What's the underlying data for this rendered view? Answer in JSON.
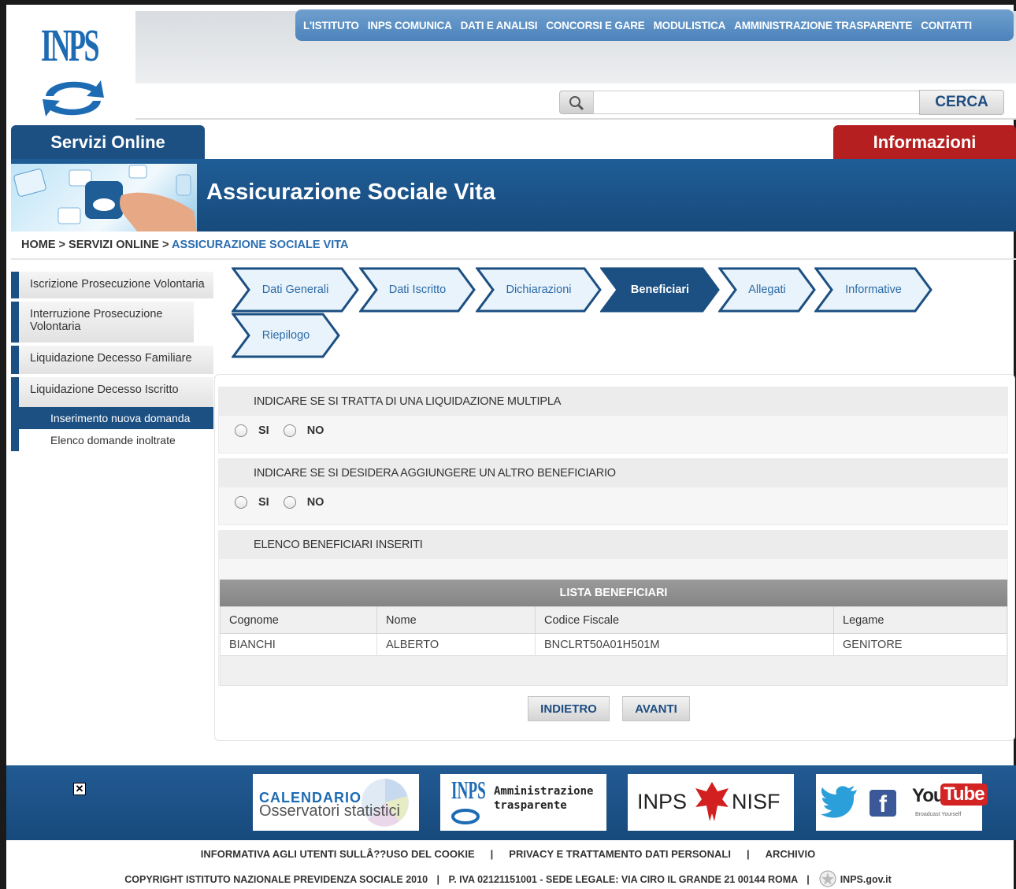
{
  "logo": {
    "text": "INPS"
  },
  "topnav": [
    "L'ISTITUTO",
    "INPS COMUNICA",
    "DATI E ANALISI",
    "CONCORSI E GARE",
    "MODULISTICA",
    "AMMINISTRAZIONE TRASPARENTE",
    "CONTATTI"
  ],
  "search": {
    "button": "CERCA",
    "placeholder": ""
  },
  "tabs": {
    "left": "Servizi Online",
    "right": "Informazioni"
  },
  "banner": {
    "title": "Assicurazione Sociale Vita"
  },
  "breadcrumb": {
    "home": "HOME",
    "sep": ">",
    "section": "SERVIZI ONLINE",
    "current": "ASSICURAZIONE SOCIALE VITA"
  },
  "sidebar": {
    "items": [
      "Iscrizione Prosecuzione Volontaria",
      "Interruzione Prosecuzione Volontaria",
      "Liquidazione Decesso Familiare",
      "Liquidazione Decesso Iscritto"
    ],
    "subitems": [
      "Inserimento nuova domanda",
      "Elenco domande inoltrate"
    ]
  },
  "steps": [
    "Dati Generali",
    "Dati Iscritto",
    "Dichiarazioni",
    "Beneficiari",
    "Allegati",
    "Informative",
    "Riepilogo"
  ],
  "active_step": "Beneficiari",
  "q1": {
    "title": "INDICARE SE SI TRATTA DI UNA LIQUIDAZIONE MULTIPLA",
    "yes": "SI",
    "no": "NO"
  },
  "q2": {
    "title": "INDICARE SE SI DESIDERA AGGIUNGERE UN ALTRO BENEFICIARIO",
    "yes": "SI",
    "no": "NO"
  },
  "q3": {
    "title": "ELENCO BENEFICIARI INSERITI"
  },
  "table": {
    "title": "LISTA BENEFICIARI",
    "headers": [
      "Cognome",
      "Nome",
      "Codice Fiscale",
      "Legame"
    ],
    "rows": [
      [
        "BIANCHI",
        "ALBERTO",
        "BNCLRT50A01H501M",
        "GENITORE"
      ]
    ]
  },
  "buttons": {
    "back": "INDIETRO",
    "next": "AVANTI"
  },
  "footer": {
    "banner1_line1": "CALENDARIO",
    "banner1_line2": "Osservatori statistici",
    "banner2_logo": "INPS",
    "banner2_line1": "Amministrazione",
    "banner2_line2": "trasparente",
    "banner3_left": "INPS",
    "banner3_right": "NISF",
    "banner4_you": "You",
    "banner4_tube": "Tube",
    "banner4_tag": "Broadcast Yourself",
    "links": [
      "INFORMATIVA AGLI UTENTI SULLÂ??USO DEL COOKIE",
      "PRIVACY E TRATTAMENTO DATI PERSONALI",
      "ARCHIVIO"
    ],
    "link_sep": "|",
    "copyright": "COPYRIGHT ISTITUTO NAZIONALE PREVIDENZA SOCIALE 2010",
    "piva": "P. IVA 02121151001 - SEDE LEGALE: VIA CIRO IL GRANDE 21 00144 ROMA",
    "govlogo": "INPS.gov.it"
  },
  "colors": {
    "primary": "#1c4f82",
    "accent": "#b51f1f",
    "link": "#2a6db0"
  },
  "icons": [
    "search-icon",
    "close-icon",
    "twitter-icon",
    "facebook-icon",
    "youtube-icon",
    "gov-emblem-icon"
  ]
}
